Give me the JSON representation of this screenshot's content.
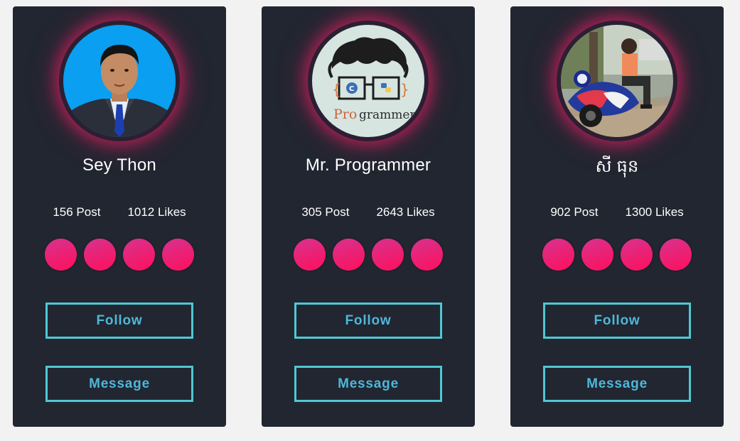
{
  "cards": [
    {
      "name": "Sey Thon",
      "posts": "156 Post",
      "likes": "1012 Likes",
      "follow_label": "Follow",
      "message_label": "Message"
    },
    {
      "name": "Mr. Programmer",
      "posts": "305 Post",
      "likes": "2643 Likes",
      "follow_label": "Follow",
      "message_label": "Message",
      "avatar_text_pro": "Pro",
      "avatar_text_grammer": "grammer",
      "avatar_badge_c": "C"
    },
    {
      "name": "សី ធុន",
      "posts": "902 Post",
      "likes": "1300 Likes",
      "follow_label": "Follow",
      "message_label": "Message"
    }
  ],
  "colors": {
    "card_bg": "#212631",
    "glow": "#e91e63",
    "button_border": "#4fc8d3",
    "button_text": "#4fb7d9",
    "social_gradient_start": "#d6338f",
    "social_gradient_end": "#ff0f5c"
  }
}
